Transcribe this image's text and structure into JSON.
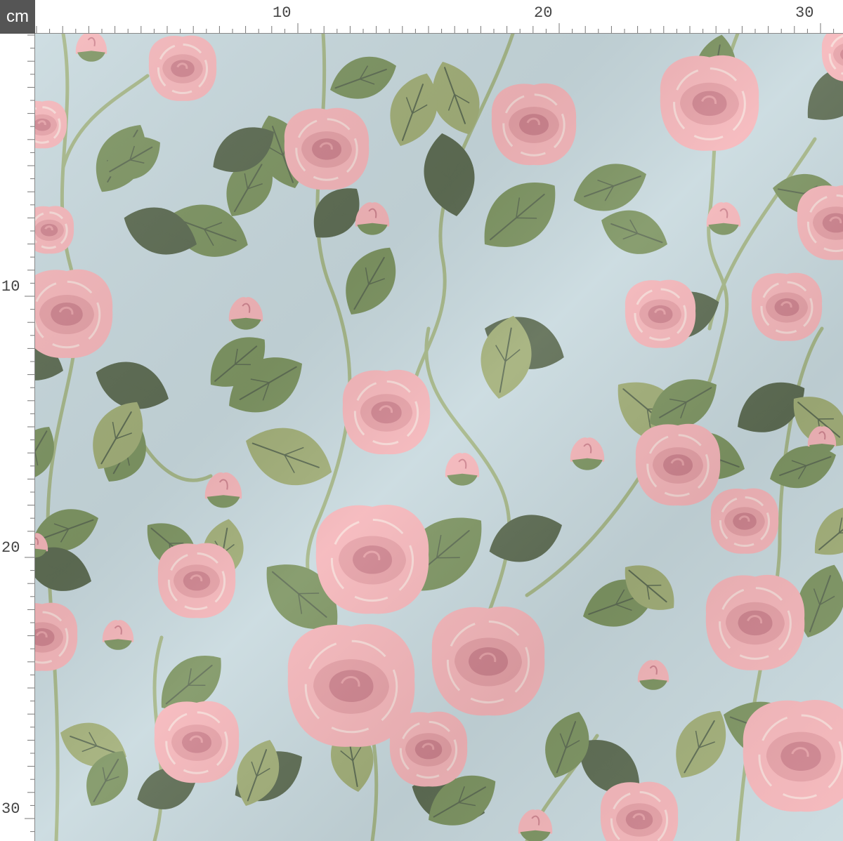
{
  "ruler": {
    "unit": "cm",
    "top_labels": [
      "10",
      "20",
      "30"
    ],
    "left_labels": [
      "10",
      "20",
      "30"
    ]
  },
  "fabric": {
    "pattern": "pink roses with green leaves on pale blue",
    "colors": {
      "background": "#c9dadf",
      "rose_light": "#f5b7bb",
      "rose_mid": "#e6a2a8",
      "rose_dark": "#cf8590",
      "leaf_light": "#a3b07a",
      "leaf_mid": "#7f9664",
      "leaf_dark": "#5f6e55",
      "stem": "#a7b88a"
    }
  }
}
